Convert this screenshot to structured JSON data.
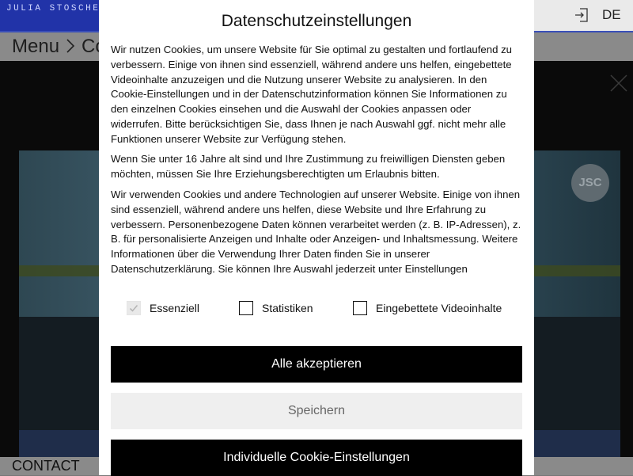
{
  "site": {
    "brand": "JULIA STOSCHEK",
    "language": "DE",
    "menu_label": "Menu",
    "breadcrumb": "Co",
    "footer_link": "CONTACT",
    "video_badge": "JSC"
  },
  "dialog": {
    "title": "Datenschutzeinstellungen",
    "paragraphs": [
      "Wir nutzen Cookies, um unsere Website für Sie optimal zu gestalten und fortlaufend zu verbessern. Einige von ihnen sind essenziell, während andere uns helfen, eingebettete Videoinhalte anzuzeigen und die Nutzung unserer Website zu analysieren. In den Cookie-Einstellungen und in der Datenschutzinformation können Sie Informationen zu den einzelnen Cookies einsehen und die Auswahl der Cookies anpassen oder widerrufen. Bitte berücksichtigen Sie, dass Ihnen je nach Auswahl ggf. nicht mehr alle Funktionen unserer Website zur Verfügung stehen.",
      "Wenn Sie unter 16 Jahre alt sind und Ihre Zustimmung zu freiwilligen Diensten geben möchten, müssen Sie Ihre Erziehungsberechtigten um Erlaubnis bitten.",
      "Wir verwenden Cookies und andere Technologien auf unserer Website. Einige von ihnen sind essenziell, während andere uns helfen, diese Website und Ihre Erfahrung zu verbessern. Personenbezogene Daten können verarbeitet werden (z. B. IP-Adressen), z. B. für personalisierte Anzeigen und Inhalte oder Anzeigen- und Inhaltsmessung. Weitere Informationen über die Verwendung Ihrer Daten finden Sie in unserer Datenschutzerklärung. Sie können Ihre Auswahl jederzeit unter Einstellungen"
    ],
    "checkboxes": [
      {
        "label": "Essenziell",
        "checked": true,
        "disabled": true
      },
      {
        "label": "Statistiken",
        "checked": false,
        "disabled": false
      },
      {
        "label": "Eingebettete Videoinhalte",
        "checked": false,
        "disabled": false
      }
    ],
    "buttons": {
      "accept_all": "Alle akzeptieren",
      "save": "Speichern",
      "custom": "Individuelle Cookie-Einstellungen"
    }
  },
  "colors": {
    "brand_blue": "#2133a8",
    "button_dark": "#000000",
    "button_light": "#efefef"
  }
}
